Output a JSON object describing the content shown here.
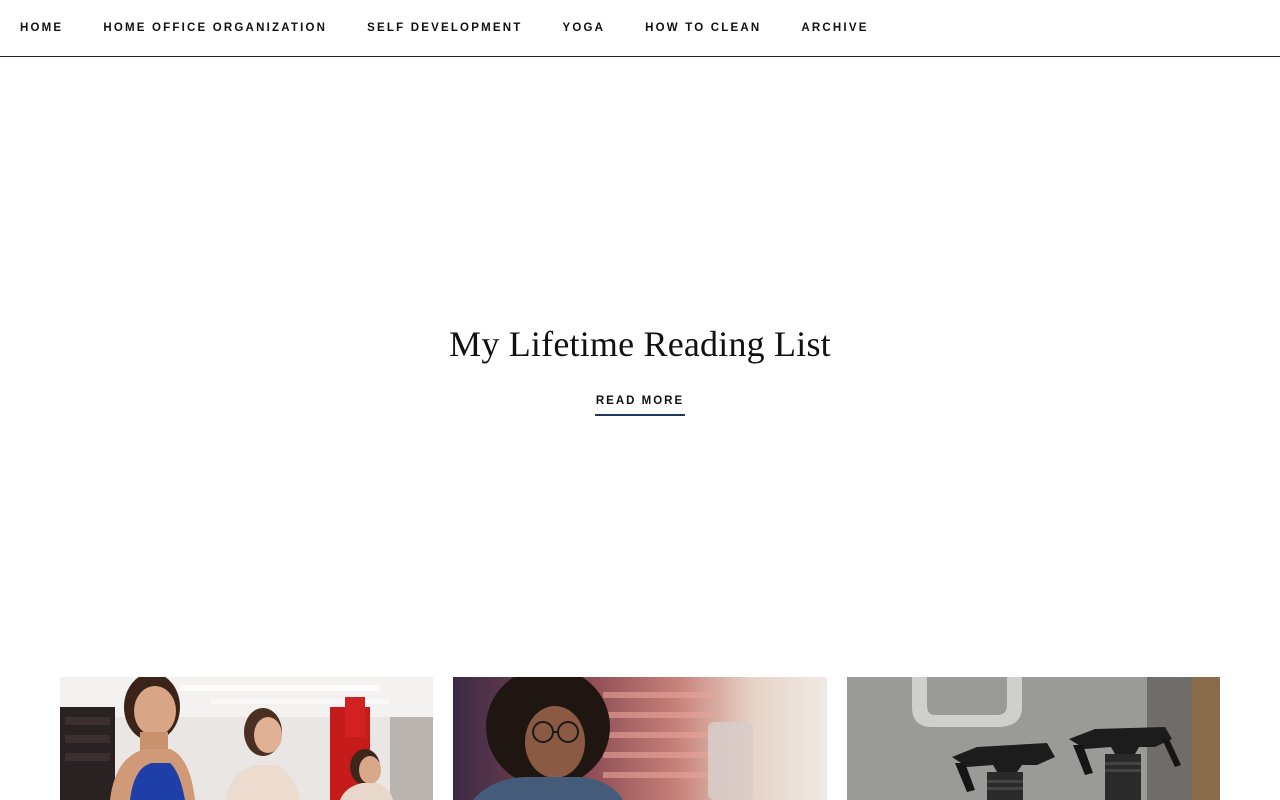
{
  "nav": {
    "items": [
      {
        "label": "HOME"
      },
      {
        "label": "HOME OFFICE ORGANIZATION"
      },
      {
        "label": "SELF DEVELOPMENT"
      },
      {
        "label": "YOGA"
      },
      {
        "label": "HOW TO CLEAN"
      },
      {
        "label": "ARCHIVE"
      }
    ]
  },
  "hero": {
    "title": "My Lifetime Reading List",
    "read_more_label": "READ MORE"
  },
  "colors": {
    "accent_underline": "#1f3a5c",
    "nav_border": "#222222"
  }
}
